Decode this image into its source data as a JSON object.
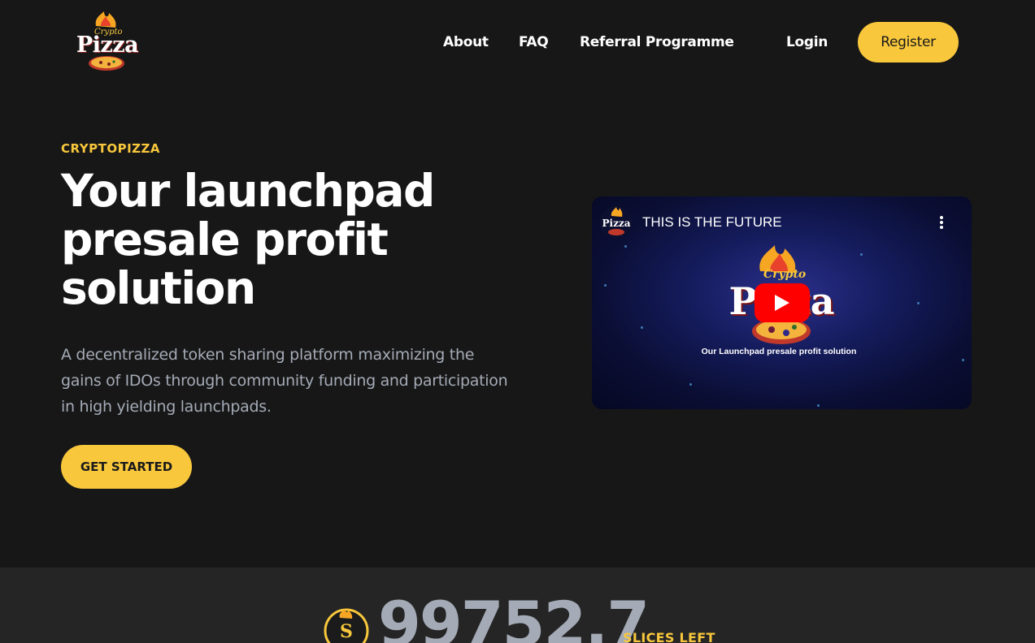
{
  "nav": {
    "logo": {
      "small": "Crypto",
      "word": "Pizza"
    },
    "links": [
      "About",
      "FAQ",
      "Referral Programme"
    ],
    "login": "Login",
    "register": "Register"
  },
  "hero": {
    "eyebrow": "CRYPTOPIZZA",
    "title": "Your launchpad presale profit solution",
    "description": "A decentralized token sharing platform maximizing the gains of IDOs through community funding and participation in high yielding launchpads.",
    "cta": "GET STARTED"
  },
  "video": {
    "title": "THIS IS THE FUTURE",
    "logo_small": "Crypto",
    "logo_word": "Pizza",
    "caption": "Our Launchpad presale profit solution",
    "play_icon": "youtube-play-icon",
    "menu_icon": "more-vertical-icon"
  },
  "stats": {
    "slices_value": "99752.7",
    "slices_label": "SLICES LEFT"
  },
  "colors": {
    "background": "#171717",
    "accent": "#f8c73c",
    "muted_text": "#a4abb6",
    "stats_bg": "#252525",
    "youtube_red": "#ff0000"
  }
}
